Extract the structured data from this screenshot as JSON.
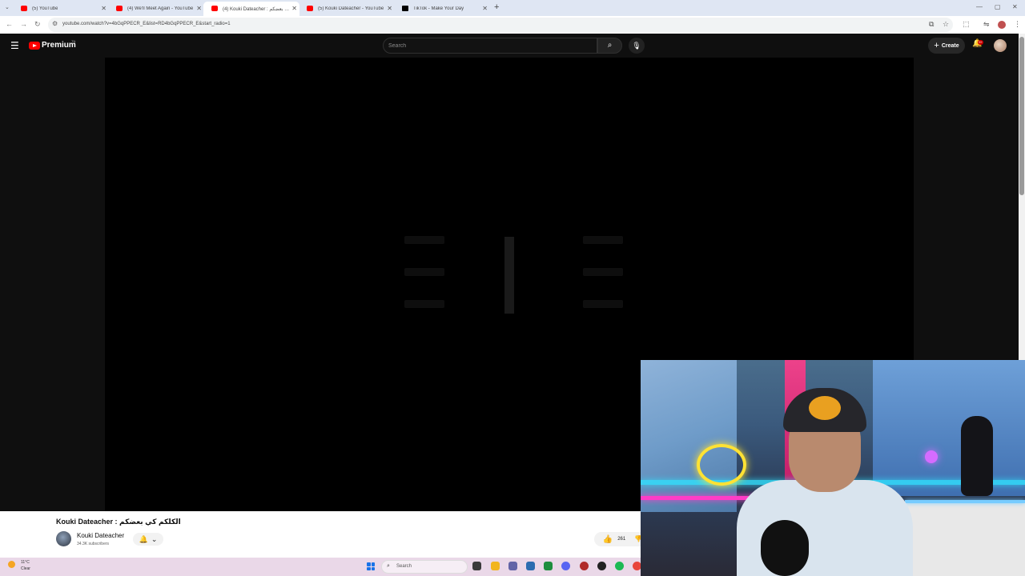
{
  "browser": {
    "tabs": [
      {
        "label": "(5) YouTube",
        "active": false,
        "favicon": "youtube-icon"
      },
      {
        "label": "(4) We'll Meet Again - YouTube",
        "active": false,
        "favicon": "youtube-icon"
      },
      {
        "label": "(4) Kouki Dateacher : الكلكم كي بعضكم",
        "active": true,
        "favicon": "youtube-icon"
      },
      {
        "label": "(5) Kouki Dateacher - YouTube",
        "active": false,
        "favicon": "youtube-icon"
      },
      {
        "label": "TikTok - Make Your Day",
        "active": false,
        "favicon": "tiktok-icon"
      }
    ],
    "new_tab_symbol": "+",
    "url": "youtube.com/watch?v=4bGqPPECR_E&list=RD4bGqPPECR_E&start_radio=1"
  },
  "youtube": {
    "logo_text": "Premium",
    "logo_superscript": "TN",
    "search_placeholder": "Search",
    "create_label": "Create",
    "notification_count": "9+",
    "video_title": "Kouki Dateacher : الكلكم كي بعضكم",
    "channel_name": "Kouki Dateacher",
    "subscribers": "34.3K subscribers",
    "likes": "261"
  },
  "taskbar": {
    "weather_temp": "11°C",
    "weather_condition": "Clear",
    "search_label": "Search",
    "app_icons": [
      "file-explorer-icon",
      "folder-icon",
      "teams-icon",
      "settings-icon",
      "excel-icon",
      "discord-icon",
      "app-icon",
      "obs-icon",
      "spotify-icon",
      "chrome-icon"
    ]
  },
  "colors": {
    "youtube_red": "#ff0000",
    "page_dark": "#0f0f0f",
    "taskbar": "#ead8e8",
    "tab_strip": "#dfe6f3"
  }
}
